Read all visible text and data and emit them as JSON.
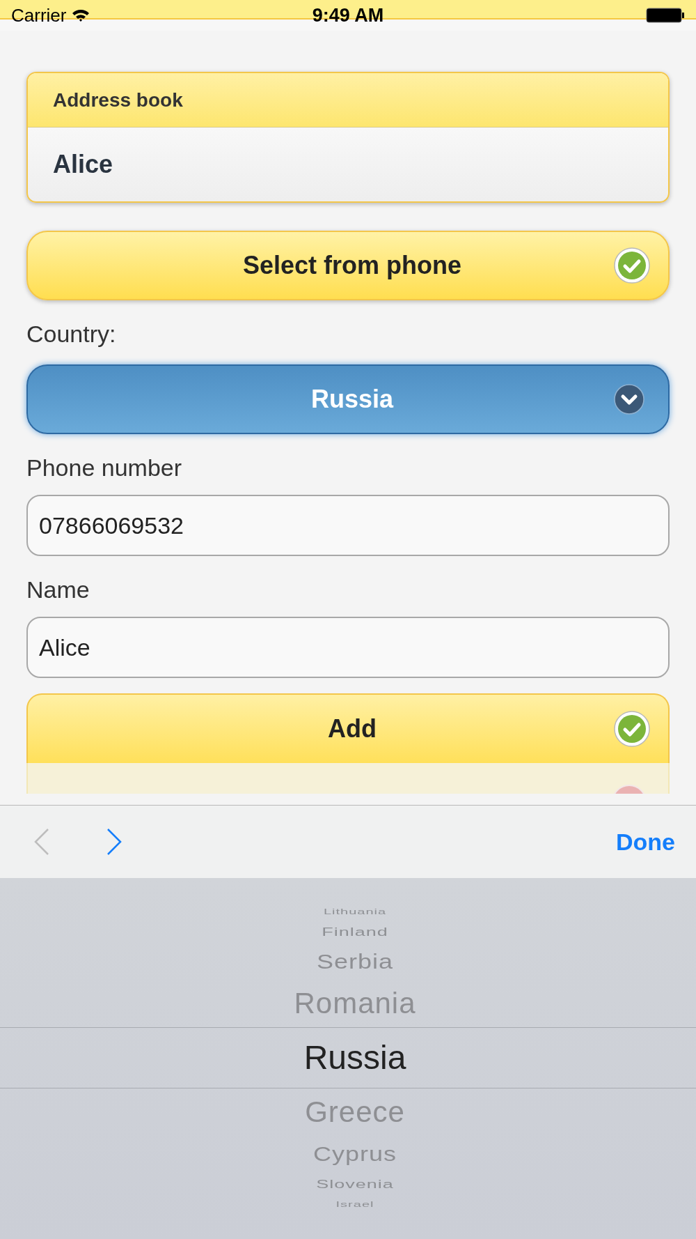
{
  "status_bar": {
    "carrier": "Carrier",
    "time": "9:49 AM"
  },
  "address_book": {
    "title": "Address book",
    "contact": "Alice"
  },
  "select_button": {
    "label": "Select from phone"
  },
  "country": {
    "label": "Country:",
    "value": "Russia"
  },
  "fields": [
    {
      "label": "Phone number",
      "value": "07866069532"
    },
    {
      "label": "Name",
      "value": "Alice"
    }
  ],
  "add_button": {
    "label": "Add"
  },
  "toolbar": {
    "previous_disabled": true,
    "next_disabled": false,
    "done": "Done"
  },
  "picker": {
    "items": [
      {
        "label": "Lithuania",
        "selected": false
      },
      {
        "label": "Finland",
        "selected": false
      },
      {
        "label": "Serbia",
        "selected": false
      },
      {
        "label": "Romania",
        "selected": false
      },
      {
        "label": "Russia",
        "selected": true
      },
      {
        "label": "Greece",
        "selected": false
      },
      {
        "label": "Cyprus",
        "selected": false
      },
      {
        "label": "Slovenia",
        "selected": false
      },
      {
        "label": "Israel",
        "selected": false
      }
    ]
  }
}
